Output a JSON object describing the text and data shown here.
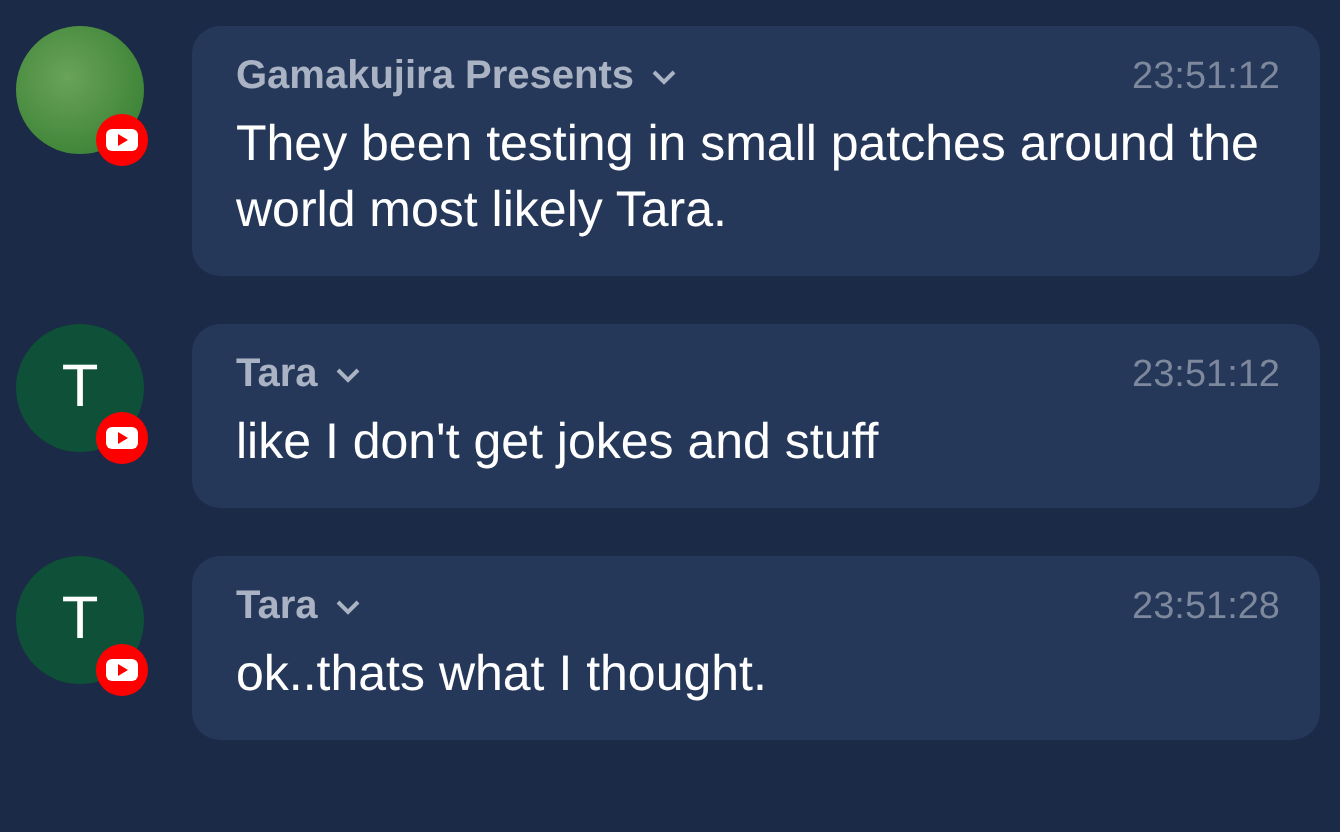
{
  "messages": [
    {
      "author": "Gamakujira Presents",
      "avatar": {
        "kind": "photo"
      },
      "time": "23:51:12",
      "text": "They been testing in small patches around the world most likely Tara."
    },
    {
      "author": "Tara",
      "avatar": {
        "kind": "letter",
        "letter": "T"
      },
      "time": "23:51:12",
      "text": "like I don't get jokes and stuff"
    },
    {
      "author": "Tara",
      "avatar": {
        "kind": "letter",
        "letter": "T"
      },
      "time": "23:51:28",
      "text": "ok..thats what I thought."
    }
  ]
}
